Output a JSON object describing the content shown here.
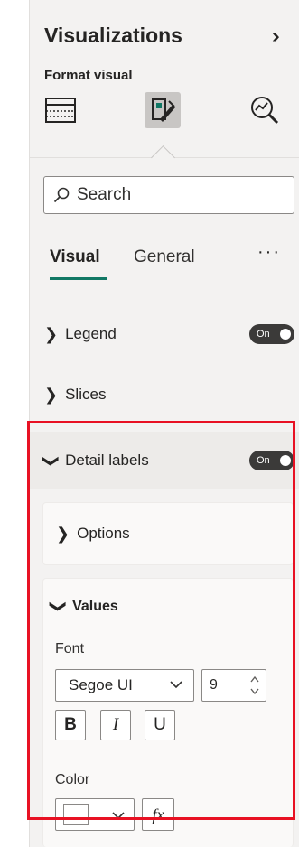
{
  "header": {
    "title": "Visualizations",
    "expand_icon": "chevron-double-right-icon",
    "subtitle": "Format visual"
  },
  "format_icons": [
    "build-visual-icon",
    "format-visual-icon",
    "analytics-icon"
  ],
  "search": {
    "placeholder": "Search"
  },
  "tabs": [
    {
      "label": "Visual",
      "active": true
    },
    {
      "label": "General",
      "active": false
    }
  ],
  "more_label": "···",
  "sections": {
    "legend": {
      "label": "Legend",
      "toggle": "On"
    },
    "slices": {
      "label": "Slices"
    },
    "detail_labels": {
      "label": "Detail labels",
      "toggle": "On"
    }
  },
  "options": {
    "label": "Options"
  },
  "values": {
    "label": "Values",
    "font_label": "Font",
    "font_family": "Segoe UI",
    "font_size": "9",
    "bold": "B",
    "italic": "I",
    "underline": "U",
    "color_label": "Color",
    "fx_label": "fx"
  },
  "colors": {
    "accent": "#117865",
    "highlight_box": "#e81123",
    "toggle_on": "#3b3a39"
  }
}
